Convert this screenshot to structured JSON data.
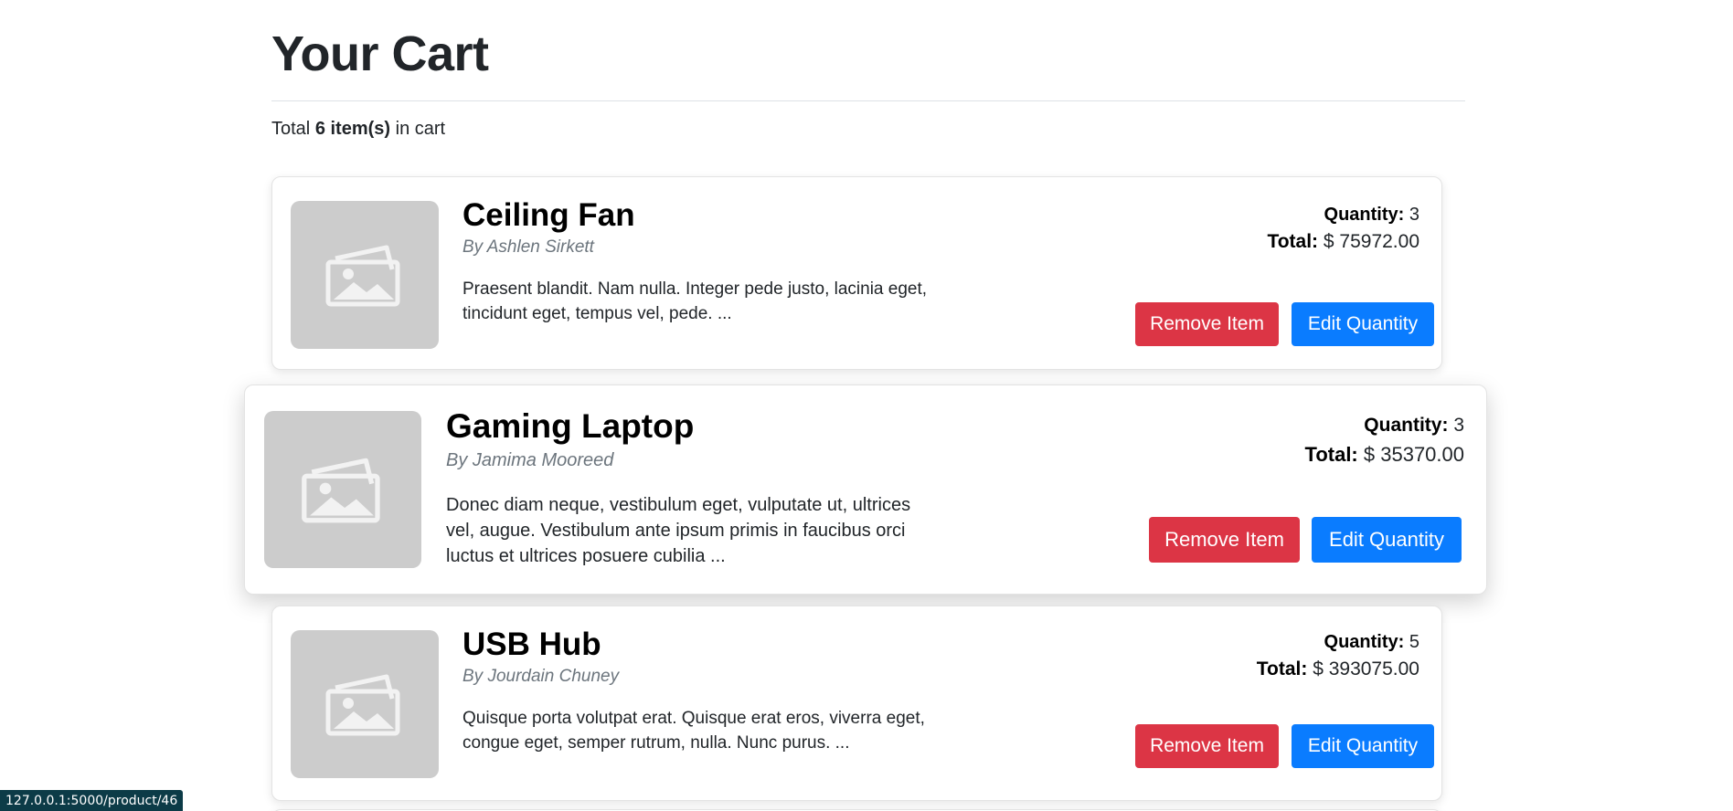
{
  "page": {
    "title": "Your Cart",
    "summary_prefix": "Total",
    "summary_count": "6 item(s)",
    "summary_suffix": "in cart"
  },
  "labels": {
    "quantity": "Quantity:",
    "total": "Total:",
    "remove": "Remove Item",
    "edit": "Edit Quantity"
  },
  "items": [
    {
      "name": "Ceiling Fan",
      "author": "By Ashlen Sirkett",
      "description": "Praesent blandit. Nam nulla. Integer pede justo, lacinia eget, tincidunt eget, tempus vel, pede. ...",
      "quantity": "3",
      "total": "$ 75972.00"
    },
    {
      "name": "Gaming Laptop",
      "author": "By Jamima Mooreed",
      "description": "Donec diam neque, vestibulum eget, vulputate ut, ultrices vel, augue. Vestibulum ante ipsum primis in faucibus orci luctus et ultrices posuere cubilia ...",
      "quantity": "3",
      "total": "$ 35370.00"
    },
    {
      "name": "USB Hub",
      "author": "By Jourdain Chuney",
      "description": "Quisque porta volutpat erat. Quisque erat eros, viverra eget, congue eget, semper rutrum, nulla. Nunc purus. ...",
      "quantity": "5",
      "total": "$ 393075.00"
    }
  ],
  "status_bar": {
    "url": "127.0.0.1:5000/product/46"
  },
  "colors": {
    "danger": "#dc3545",
    "primary": "#0a7cff",
    "placeholder": "#cccccc"
  },
  "icons": {
    "thumbnail": "image-placeholder-icon"
  }
}
